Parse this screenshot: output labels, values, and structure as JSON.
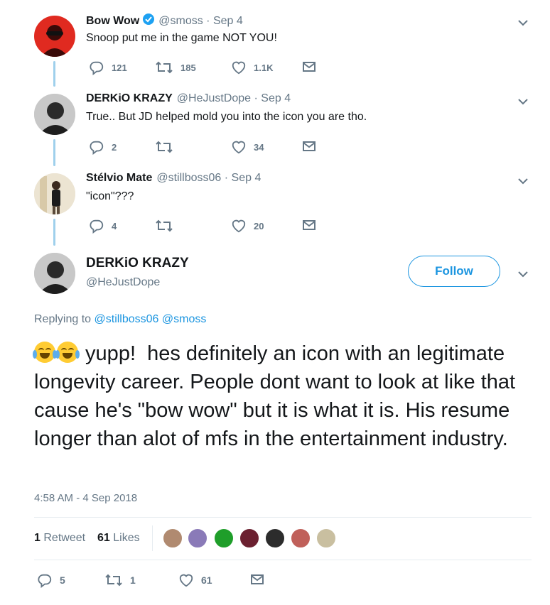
{
  "tweets": [
    {
      "name": "Bow Wow",
      "handle": "@smoss",
      "sep": " · ",
      "date": "Sep 4",
      "text": "Snoop put me in the game NOT YOU!",
      "replies": "121",
      "retweets": "185",
      "likes": "1.1K",
      "verified": true
    },
    {
      "name": "DERKiO KRAZY",
      "handle": "@HeJustDope",
      "sep": " · ",
      "date": "Sep 4",
      "text": "True.. But JD helped mold you into the icon you are tho.",
      "replies": "2",
      "retweets": "",
      "likes": "34"
    },
    {
      "name": "Stélvio Mate",
      "handle": "@stillboss06",
      "sep": " · ",
      "date": "Sep 4",
      "text": "\"icon\"???",
      "replies": "4",
      "retweets": "",
      "likes": "20"
    }
  ],
  "main": {
    "name": "DERKiO KRAZY",
    "handle": "@HeJustDope",
    "follow_label": "Follow",
    "replying_prefix": "Replying to ",
    "replying_to": [
      "@stillboss06",
      "@smoss"
    ],
    "text": " yupp!  hes definitely an icon with an legitimate longevity career. People dont want to look at like that cause he's \"bow wow\" but it is what it is. His resume longer than alot of mfs in the entertainment industry.",
    "timestamp": "4:58 AM - 4 Sep 2018",
    "retweet_count": "1",
    "retweet_label": "Retweet",
    "like_count": "61",
    "like_label": "Likes",
    "actions": {
      "replies": "5",
      "retweets": "1",
      "likes": "61"
    }
  },
  "colors": {
    "accent": "#1b95e0",
    "muted": "#657786",
    "thread": "#9fd0ec"
  }
}
